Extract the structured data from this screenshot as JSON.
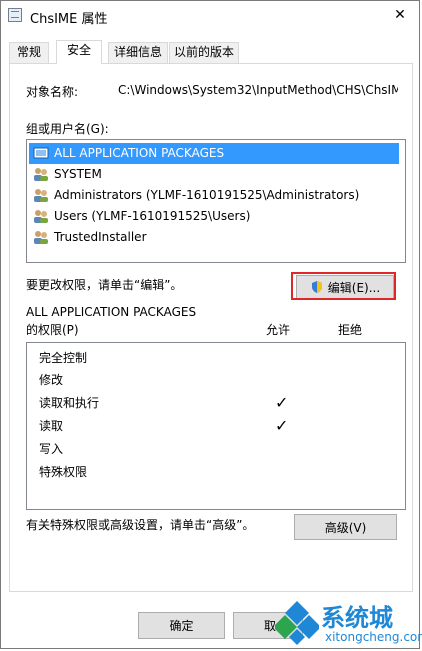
{
  "window": {
    "title": "ChsIME 属性",
    "close_glyph": "✕"
  },
  "tabs": [
    {
      "label": "常规",
      "active": false
    },
    {
      "label": "安全",
      "active": true
    },
    {
      "label": "详细信息",
      "active": false
    },
    {
      "label": "以前的版本",
      "active": false
    }
  ],
  "object": {
    "label": "对象名称:",
    "value": "C:\\Windows\\System32\\InputMethod\\CHS\\ChsIM"
  },
  "groups": {
    "label": "组或用户名(G):",
    "items": [
      {
        "label": "ALL APPLICATION PACKAGES",
        "icon": "app-packages-icon",
        "selected": true
      },
      {
        "label": "SYSTEM",
        "icon": "users-icon"
      },
      {
        "label": "Administrators (YLMF-1610191525\\Administrators)",
        "icon": "users-icon"
      },
      {
        "label": "Users (YLMF-1610191525\\Users)",
        "icon": "users-icon"
      },
      {
        "label": "TrustedInstaller",
        "icon": "users-icon"
      }
    ]
  },
  "edit_hint": "要更改权限，请单击“编辑”。",
  "edit_button": "编辑(E)...",
  "permissions": {
    "for_label_line1": "ALL APPLICATION PACKAGES",
    "for_label_line2": "的权限(P)",
    "allow_header": "允许",
    "deny_header": "拒绝",
    "rows": [
      {
        "name": "完全控制",
        "allow": "",
        "deny": ""
      },
      {
        "name": "修改",
        "allow": "",
        "deny": ""
      },
      {
        "name": "读取和执行",
        "allow": "✓",
        "deny": ""
      },
      {
        "name": "读取",
        "allow": "✓",
        "deny": ""
      },
      {
        "name": "写入",
        "allow": "",
        "deny": ""
      },
      {
        "name": "特殊权限",
        "allow": "",
        "deny": ""
      }
    ]
  },
  "advanced_hint": "有关特殊权限或高级设置，请单击“高级”。",
  "advanced_button": "高级(V)",
  "footer": {
    "ok_button": "确定",
    "cancel_button": "取"
  },
  "watermark": {
    "brand": "系统城",
    "url": "xitongcheng.com"
  },
  "colors": {
    "selection": "#3399ff",
    "highlight_border": "#e0252b",
    "watermark_blue": "#1e88d6"
  }
}
